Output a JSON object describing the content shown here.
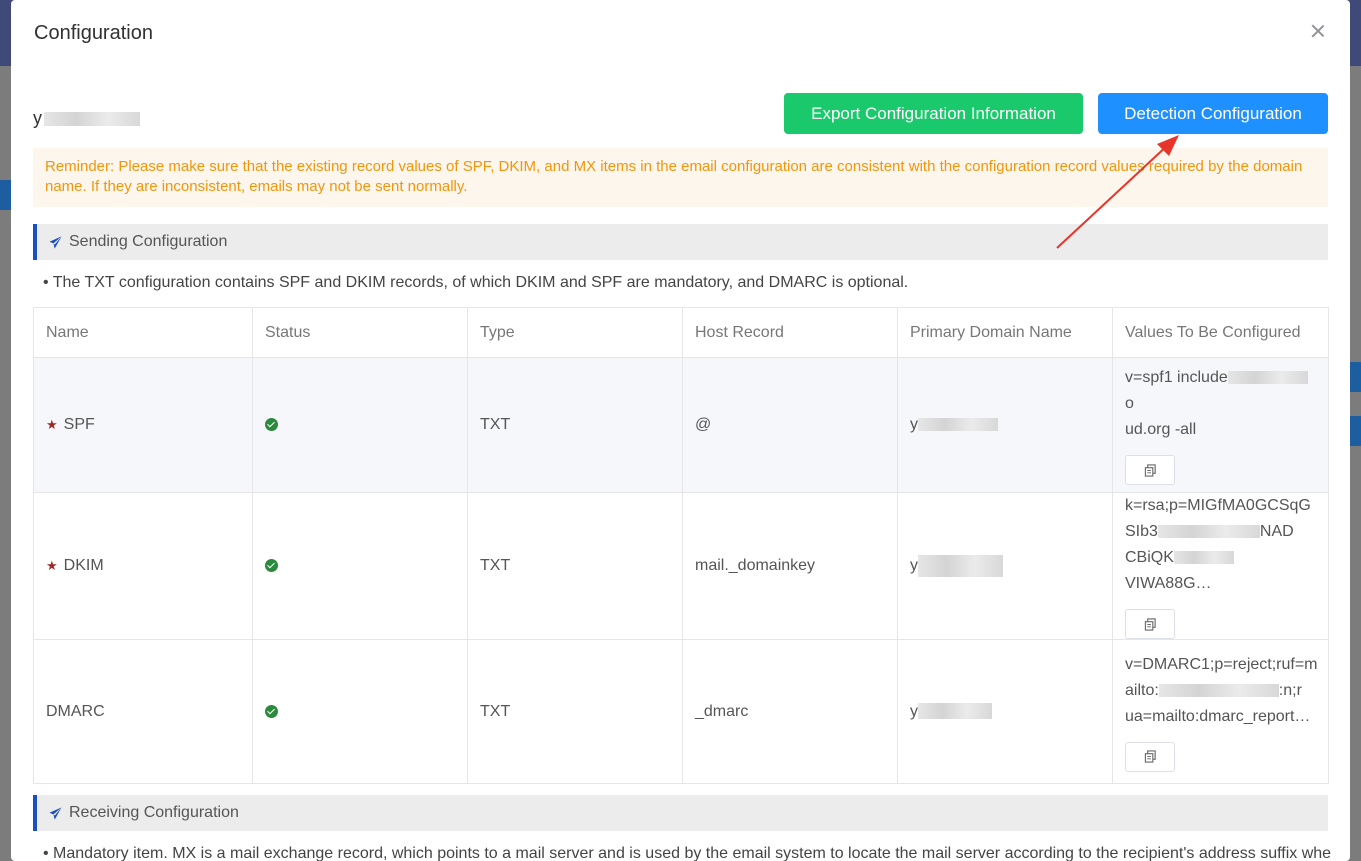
{
  "modal": {
    "title": "Configuration",
    "domain_prefix": "y",
    "export_button": "Export Configuration Information",
    "detect_button": "Detection Configuration",
    "reminder": "Reminder: Please make sure that the existing record values of SPF, DKIM, and MX items in the email configuration are consistent with the configuration record values required by the domain name. If they are inconsistent, emails may not be sent normally."
  },
  "sending": {
    "title": "Sending Configuration",
    "note": "• The TXT configuration contains SPF and DKIM records, of which DKIM and SPF are mandatory, and DMARC is optional.",
    "columns": [
      "Name",
      "Status",
      "Type",
      "Host Record",
      "Primary Domain Name",
      "Values To Be Configured"
    ],
    "rows": [
      {
        "name": "SPF",
        "required": true,
        "type": "TXT",
        "host": "@",
        "domain_prefix": "y",
        "value_lines": [
          "v=spf1 include",
          "o",
          "ud.org -all"
        ]
      },
      {
        "name": "DKIM",
        "required": true,
        "type": "TXT",
        "host": "mail._domainkey",
        "domain_prefix": "y",
        "value_lines": [
          "k=rsa;p=MIGfMA0GCSqG",
          "SIb3",
          "NAD",
          "CBiQK",
          "VIWA88G…"
        ]
      },
      {
        "name": "DMARC",
        "required": false,
        "type": "TXT",
        "host": "_dmarc",
        "domain_prefix": "y",
        "value_lines": [
          "v=DMARC1;p=reject;ruf=m",
          "ailto:",
          ":n;r",
          "ua=mailto:dmarc_report…"
        ]
      }
    ]
  },
  "receiving": {
    "title": "Receiving Configuration",
    "note": "• Mandatory item. MX is a mail exchange record, which points to a mail server and is used by the email system to locate the mail server according to the recipient's address suffix whe"
  },
  "colors": {
    "export": "#19c96b",
    "detect": "#1e90ff",
    "reminder_text": "#f0960d",
    "section_accent": "#1a4fc1",
    "status_ok": "#2b8a3e",
    "arrow": "#e8352b"
  },
  "icons": [
    "close-icon",
    "paper-plane-icon",
    "star-icon",
    "check-circle-icon",
    "copy-icon"
  ]
}
